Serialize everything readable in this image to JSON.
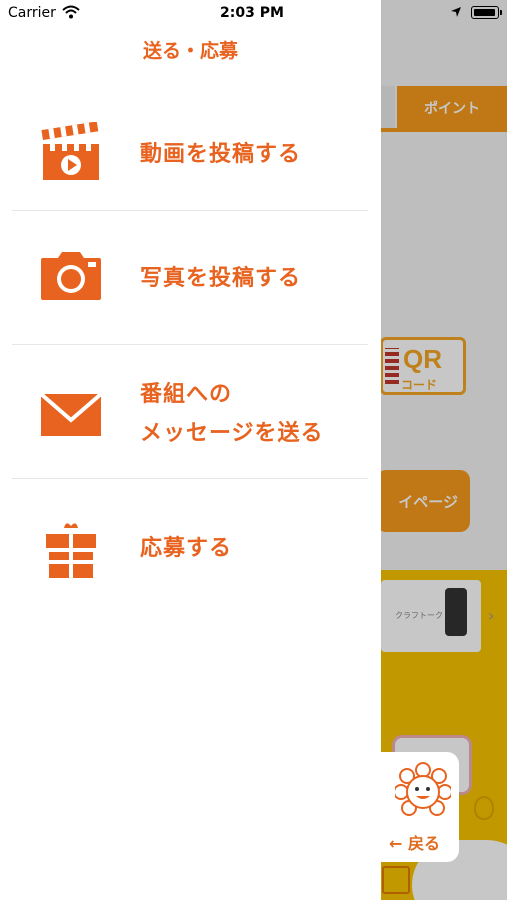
{
  "status_bar": {
    "carrier": "Carrier",
    "time": "2:03 PM"
  },
  "drawer": {
    "title": "送る・応募",
    "items": [
      {
        "label": "動画を投稿する",
        "icon": "video-clapperboard-icon"
      },
      {
        "label": "写真を投稿する",
        "icon": "camera-icon"
      },
      {
        "label_line1": "番組への",
        "label_line2": "メッセージを送る",
        "icon": "envelope-icon"
      },
      {
        "label": "応募する",
        "icon": "gift-icon"
      }
    ]
  },
  "background": {
    "tab_point": "ポイント",
    "qr_big": "QR",
    "qr_small": "コード",
    "mypage": "イページ",
    "banner_text": "クラフトーク"
  },
  "back_button": {
    "label": "← 戻る"
  },
  "colors": {
    "accent": "#e8631f",
    "orange_tab": "#f59a1b",
    "yellow_bg": "#f8c300"
  }
}
